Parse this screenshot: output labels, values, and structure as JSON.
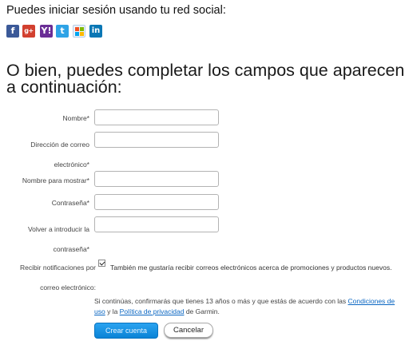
{
  "social": {
    "title": "Puedes iniciar sesión usando tu red social:",
    "icons": [
      {
        "name": "facebook-icon",
        "glyph": "f",
        "color": "#3b5998"
      },
      {
        "name": "google-plus-icon",
        "glyph": "g+",
        "color": "#d2402f"
      },
      {
        "name": "yahoo-icon",
        "glyph": "Y!",
        "color": "#6a2e96"
      },
      {
        "name": "twitter-icon",
        "glyph": "t",
        "color": "#2ea3e6"
      },
      {
        "name": "windows-live-icon",
        "glyph": "",
        "color": "#eaf2fb"
      },
      {
        "name": "linkedin-icon",
        "glyph": "in",
        "color": "#0a77b5"
      }
    ]
  },
  "form": {
    "heading": "O bien, puedes completar los campos que aparecen a continuación:",
    "fields": [
      {
        "label": "Nombre*",
        "value": ""
      },
      {
        "label": "Dirección de correo electrónico*",
        "value": ""
      },
      {
        "label": "Nombre para mostrar*",
        "value": ""
      },
      {
        "label": "Contraseña*",
        "value": ""
      },
      {
        "label": "Volver a introducir la contraseña*",
        "value": ""
      }
    ],
    "notifications": {
      "label": "Recibir notificaciones por correo electrónico:",
      "checked": true,
      "text": "También me gustaría recibir correos electrónicos acerca de promociones y productos nuevos."
    },
    "terms": {
      "prefix": "Si continúas, confirmarás que tienes 13 años o más y que estás de acuerdo con las ",
      "terms_link": "Condiciones de uso",
      "middle": " y la ",
      "privacy_link": "Política de privacidad",
      "suffix": " de Garmin."
    },
    "buttons": {
      "create": "Crear cuenta",
      "cancel": "Cancelar"
    }
  },
  "colors": {
    "primary_button": "#1a93e3",
    "link": "#0a66c2"
  }
}
